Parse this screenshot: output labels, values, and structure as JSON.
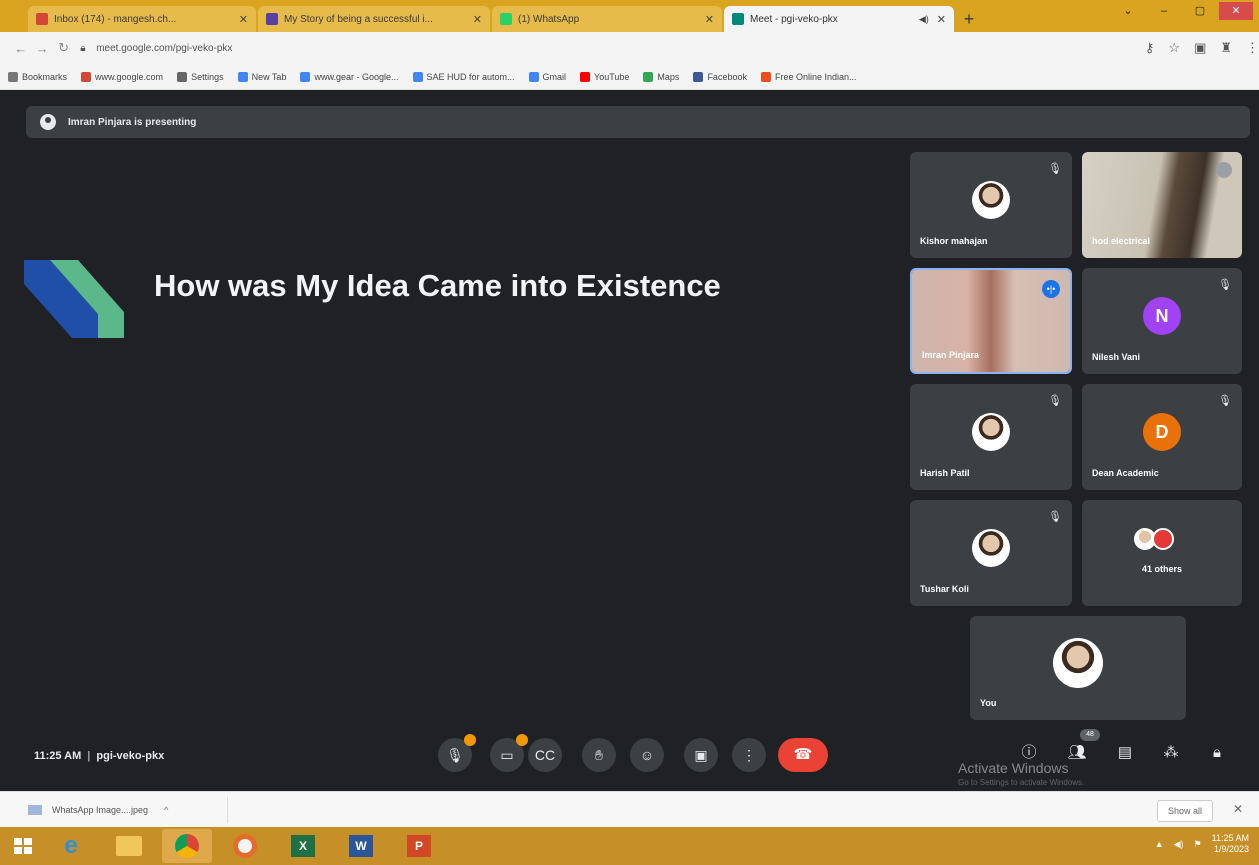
{
  "browser": {
    "tabs": [
      {
        "label": "Inbox (174) - mangesh.ch...",
        "favicon_color": "#d44638",
        "active": false
      },
      {
        "label": "My Story of being a successful i...",
        "favicon_color": "#5b3fa8",
        "active": false
      },
      {
        "label": "(1) WhatsApp",
        "favicon_color": "#25d366",
        "active": false
      },
      {
        "label": "Meet - pgi-veko-pkx",
        "favicon_color": "#00897b",
        "active": true
      }
    ],
    "address": "meet.google.com/pgi-veko-pkx",
    "bookmarks": [
      {
        "label": "Bookmarks",
        "color": "#777777"
      },
      {
        "label": "www.google.com",
        "color": "#d44638"
      },
      {
        "label": "Settings",
        "color": "#666666"
      },
      {
        "label": "New Tab",
        "color": "#4285f4"
      },
      {
        "label": "www.gear - Google...",
        "color": "#4285f4"
      },
      {
        "label": "SAE HUD for autom...",
        "color": "#4285f4"
      },
      {
        "label": "Gmail",
        "color": "#4285f4"
      },
      {
        "label": "YouTube",
        "color": "#ff0000"
      },
      {
        "label": "Maps",
        "color": "#34a853"
      },
      {
        "label": "Facebook",
        "color": "#3b5998"
      },
      {
        "label": "Free Online Indian...",
        "color": "#e94e1b"
      }
    ]
  },
  "meet": {
    "presenting_text": "Imran Pinjara is presenting",
    "slide_title": "How was My Idea Came into Existence",
    "participants": [
      {
        "name": "Kishor mahajan",
        "type": "photo"
      },
      {
        "name": "hod electrical",
        "type": "video"
      },
      {
        "name": "Imran Pinjara",
        "type": "video",
        "speaking": true
      },
      {
        "name": "Nilesh Vani",
        "type": "initial",
        "initial": "N",
        "color": "#a142f4"
      },
      {
        "name": "Harish Patil",
        "type": "photo"
      },
      {
        "name": "Dean Academic",
        "type": "initial",
        "initial": "D",
        "color": "#e8710a"
      },
      {
        "name": "Tushar Koli",
        "type": "photo"
      },
      {
        "name": "41 others",
        "type": "others"
      }
    ],
    "self_label": "You",
    "time": "11:25 AM",
    "meeting_code": "pgi-veko-pkx",
    "people_count": "48",
    "watermark": "Activate Windows",
    "watermark_sub": "Go to Settings to activate Windows."
  },
  "downloads": {
    "file": "WhatsApp Image....jpeg",
    "show_all": "Show all"
  },
  "taskbar": {
    "time": "11:25 AM",
    "date": "1/9/2023"
  }
}
